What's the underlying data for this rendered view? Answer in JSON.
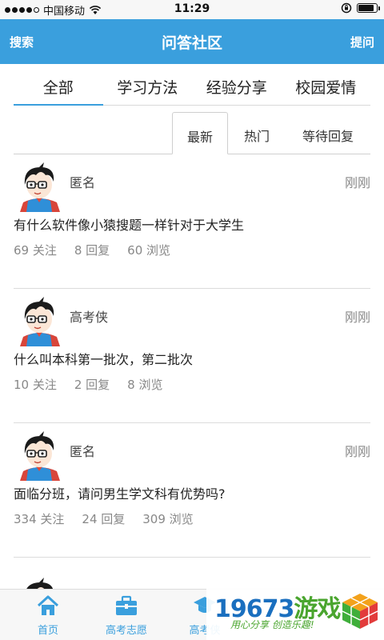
{
  "status": {
    "carrier": "中国移动",
    "time": "11:29",
    "battery_level": 0.85
  },
  "nav": {
    "left": "搜索",
    "title": "问答社区",
    "right": "提问",
    "color": "#3a9fdd"
  },
  "categories": [
    {
      "label": "全部",
      "active": true
    },
    {
      "label": "学习方法",
      "active": false
    },
    {
      "label": "经验分享",
      "active": false
    },
    {
      "label": "校园爱情",
      "active": false
    }
  ],
  "sort_tabs": [
    {
      "label": "最新",
      "active": true
    },
    {
      "label": "热门",
      "active": false
    },
    {
      "label": "等待回复",
      "active": false
    }
  ],
  "questions": [
    {
      "author": "匿名",
      "time": "刚刚",
      "title": "有什么软件像小猿搜题一样针对于大学生",
      "follows": "69 关注",
      "replies": "8 回复",
      "views": "60 浏览"
    },
    {
      "author": "高考侠",
      "time": "刚刚",
      "title": "什么叫本科第一批次，第二批次",
      "follows": "10 关注",
      "replies": "2 回复",
      "views": "8 浏览"
    },
    {
      "author": "匿名",
      "time": "刚刚",
      "title": "面临分班，请问男生学文科有优势吗?",
      "follows": "334 关注",
      "replies": "24 回复",
      "views": "309 浏览"
    }
  ],
  "tab_bar": [
    {
      "label": "首页",
      "icon": "home-icon"
    },
    {
      "label": "高考志愿",
      "icon": "briefcase-icon"
    },
    {
      "label": "高考侠",
      "icon": "graduation-cap-icon"
    }
  ],
  "watermark": {
    "number": "19673",
    "game": "游戏",
    "slogan": "用心分享 创造乐趣!"
  }
}
